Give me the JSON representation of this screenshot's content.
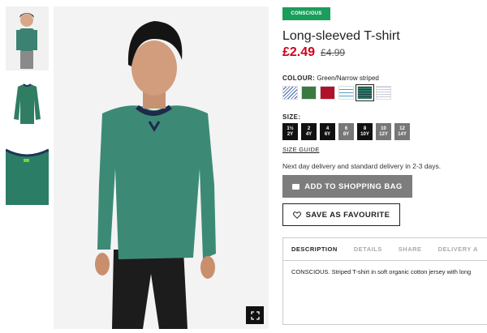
{
  "product": {
    "badge": "CONSCIOUS",
    "title": "Long-sleeved T-shirt",
    "price_sale": "£2.49",
    "price_old": "£4.99"
  },
  "colour": {
    "label": "COLOUR:",
    "selected": "Green/Narrow striped",
    "swatches": [
      {
        "name": "blue-white-pattern",
        "color": "#dfe5f2"
      },
      {
        "name": "green",
        "color": "#3a7a3e"
      },
      {
        "name": "red",
        "color": "#b0102a"
      },
      {
        "name": "white-blue-stripe",
        "color": "#e8f2f6"
      },
      {
        "name": "green-narrow-striped",
        "color": "#2e7d66"
      },
      {
        "name": "white-grey-stripe",
        "color": "#eef0f4"
      }
    ]
  },
  "size": {
    "label": "SIZE:",
    "options": [
      "1½\n2Y",
      "2\n4Y",
      "4\n6Y",
      "6\n8Y",
      "8\n10Y",
      "10\n12Y",
      "12\n14Y"
    ],
    "guide_label": "SIZE GUIDE"
  },
  "delivery_text": "Next day delivery and standard delivery in 2-3 days.",
  "actions": {
    "add_to_bag": "ADD TO SHOPPING BAG",
    "save_favourite": "SAVE AS FAVOURITE"
  },
  "tabs": {
    "items": [
      "DESCRIPTION",
      "DETAILS",
      "SHARE",
      "DELIVERY A"
    ],
    "content": "CONSCIOUS. Striped T-shirt in soft organic cotton jersey with long"
  },
  "colors": {
    "accent_sale": "#d0011b",
    "badge_green": "#1a9e5c",
    "shirt_green": "#2e7d66"
  }
}
